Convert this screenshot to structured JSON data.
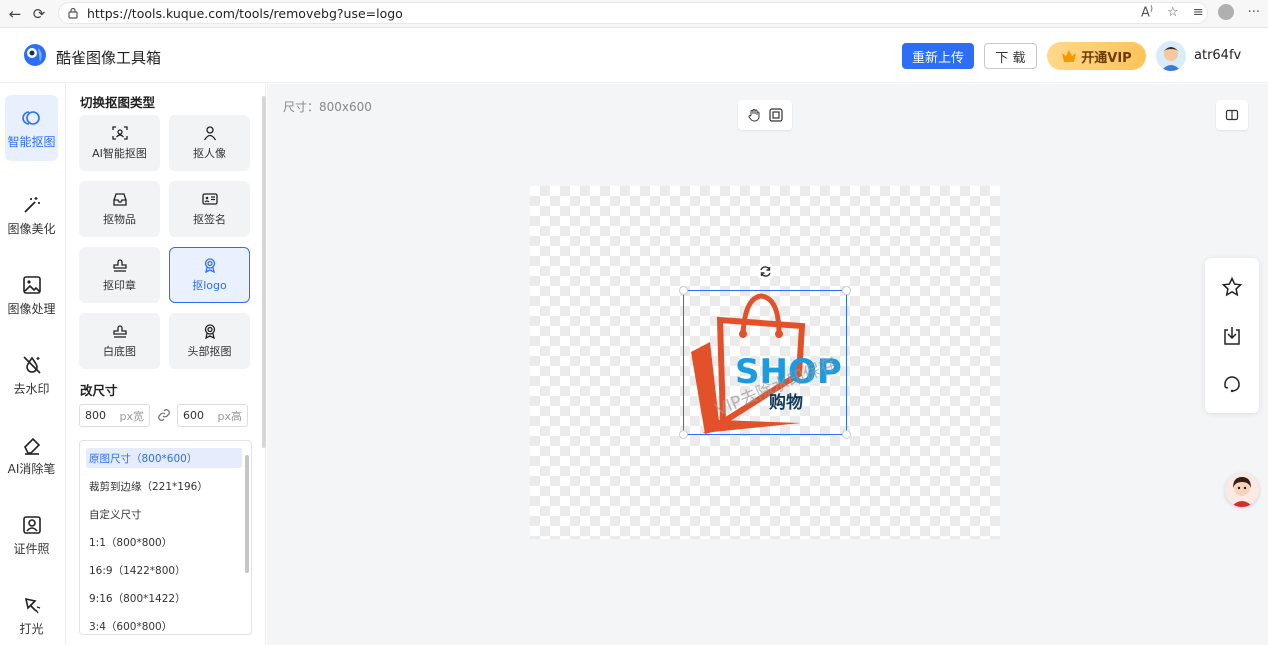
{
  "browser": {
    "url": "https://tools.kuque.com/tools/removebg?use=logo"
  },
  "header": {
    "app_title": "酷雀图像工具箱",
    "reupload_label": "重新上传",
    "download_label": "下 载",
    "vip_label": "开通VIP",
    "username": "atr64fv"
  },
  "leftnav": {
    "items": [
      {
        "label": "智能抠图",
        "icon": "smart-cutout-icon",
        "active": true
      },
      {
        "label": "图像美化",
        "icon": "magic-wand-icon"
      },
      {
        "label": "图像处理",
        "icon": "image-icon"
      },
      {
        "label": "去水印",
        "icon": "remove-watermark-icon"
      },
      {
        "label": "AI消除笔",
        "icon": "eraser-icon"
      },
      {
        "label": "证件照",
        "icon": "id-photo-icon"
      },
      {
        "label": "打光",
        "icon": "lighting-icon"
      }
    ]
  },
  "panel": {
    "type_title": "切换抠图类型",
    "types": [
      {
        "label": "AI智能抠图",
        "icon": "ai-scan-icon"
      },
      {
        "label": "抠人像",
        "icon": "person-icon"
      },
      {
        "label": "抠物品",
        "icon": "inbox-icon"
      },
      {
        "label": "抠签名",
        "icon": "signature-card-icon"
      },
      {
        "label": "抠印章",
        "icon": "stamp-icon"
      },
      {
        "label": "抠logo",
        "icon": "badge-icon",
        "selected": true
      },
      {
        "label": "白底图",
        "icon": "stamp-icon"
      },
      {
        "label": "头部抠图",
        "icon": "badge-icon"
      }
    ],
    "resize_title": "改尺寸",
    "width_value": "800",
    "width_unit": "px宽",
    "height_value": "600",
    "height_unit": "px高",
    "size_options": [
      {
        "label": "原图尺寸（800*600）",
        "selected": true
      },
      {
        "label": "裁剪到边缘（221*196）"
      },
      {
        "label": "自定义尺寸"
      },
      {
        "label": "1:1（800*800）"
      },
      {
        "label": "16:9（1422*800）"
      },
      {
        "label": "9:16（800*1422）"
      },
      {
        "label": "3:4（600*800）"
      }
    ]
  },
  "workspace": {
    "dimension_text": "尺寸：800x600",
    "logo_text_main": "SHOP",
    "logo_text_sub": "购物",
    "watermark_text": "VIP去除水印保存"
  },
  "colors": {
    "accent": "#2c6ef6",
    "logo_orange": "#e2512a",
    "logo_blue": "#1d9be0",
    "logo_dark": "#123a5a"
  }
}
